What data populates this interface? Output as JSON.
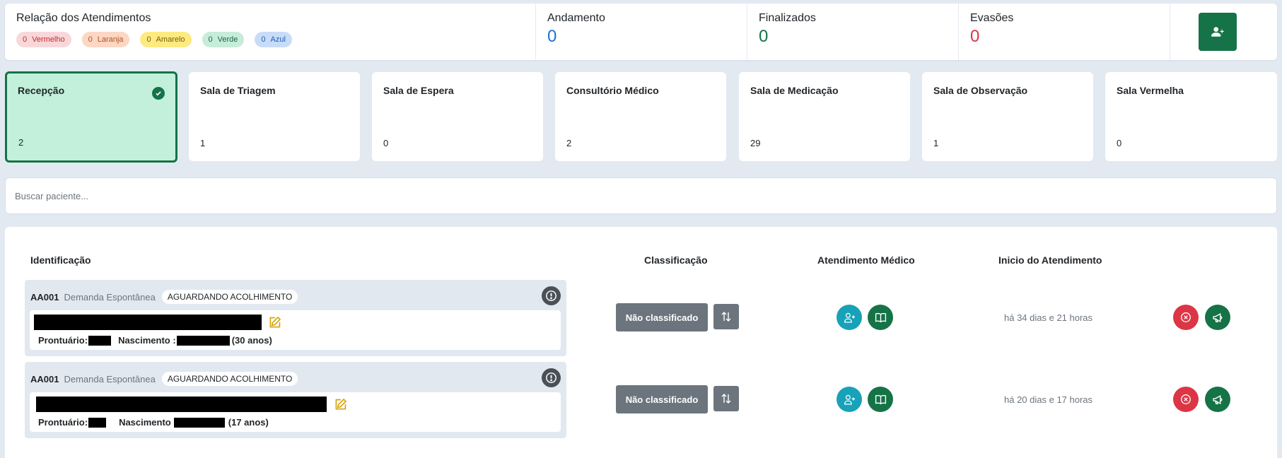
{
  "summary": {
    "title": "Relação dos Atendimentos",
    "badges": [
      {
        "count": "0",
        "label": "Vermelho"
      },
      {
        "count": "0",
        "label": "Laranja"
      },
      {
        "count": "0",
        "label": "Amarelo"
      },
      {
        "count": "0",
        "label": "Verde"
      },
      {
        "count": "0",
        "label": "Azul"
      }
    ],
    "stats": [
      {
        "label": "Andamento",
        "value": "0",
        "color": "#1f6fd6"
      },
      {
        "label": "Finalizados",
        "value": "0",
        "color": "#157347"
      },
      {
        "label": "Evasões",
        "value": "0",
        "color": "#dc3545"
      }
    ],
    "add_button_icon": "user-plus-icon"
  },
  "rooms": [
    {
      "name": "Recepção",
      "count": "2",
      "active": true
    },
    {
      "name": "Sala de Triagem",
      "count": "1"
    },
    {
      "name": "Sala de Espera",
      "count": "0"
    },
    {
      "name": "Consultório Médico",
      "count": "2"
    },
    {
      "name": "Sala de Medicação",
      "count": "29"
    },
    {
      "name": "Sala de Observação",
      "count": "1"
    },
    {
      "name": "Sala Vermelha",
      "count": "0"
    }
  ],
  "search": {
    "placeholder": "Buscar paciente..."
  },
  "table": {
    "headers": {
      "identificacao": "Identificação",
      "classificacao": "Classificação",
      "atendimento": "Atendimento Médico",
      "inicio": "Inicio do Atendimento"
    },
    "rows": [
      {
        "code": "AA001",
        "demand": "Demanda Espontânea",
        "status": "AGUARDANDO ACOLHIMENTO",
        "prontuario_label": "Prontuário:",
        "nascimento_label": "Nascimento :",
        "age": "(30 anos)",
        "classification": "Não classificado",
        "since": "há 34 dias e 21 horas"
      },
      {
        "code": "AA001",
        "demand": "Demanda Espontânea",
        "status": "AGUARDANDO ACOLHIMENTO",
        "prontuario_label": "Prontuário:",
        "nascimento_label": "Nascimento",
        "age": "(17 anos)",
        "classification": "Não classificado",
        "since": "há 20 dias e 17 horas"
      }
    ]
  },
  "colors": {
    "primary_green": "#157347",
    "active_room_bg": "#c3f0da",
    "cyan": "#17a2b8",
    "danger": "#dc3545",
    "secondary": "#6c757d",
    "page_bg": "#e3e9f1"
  }
}
